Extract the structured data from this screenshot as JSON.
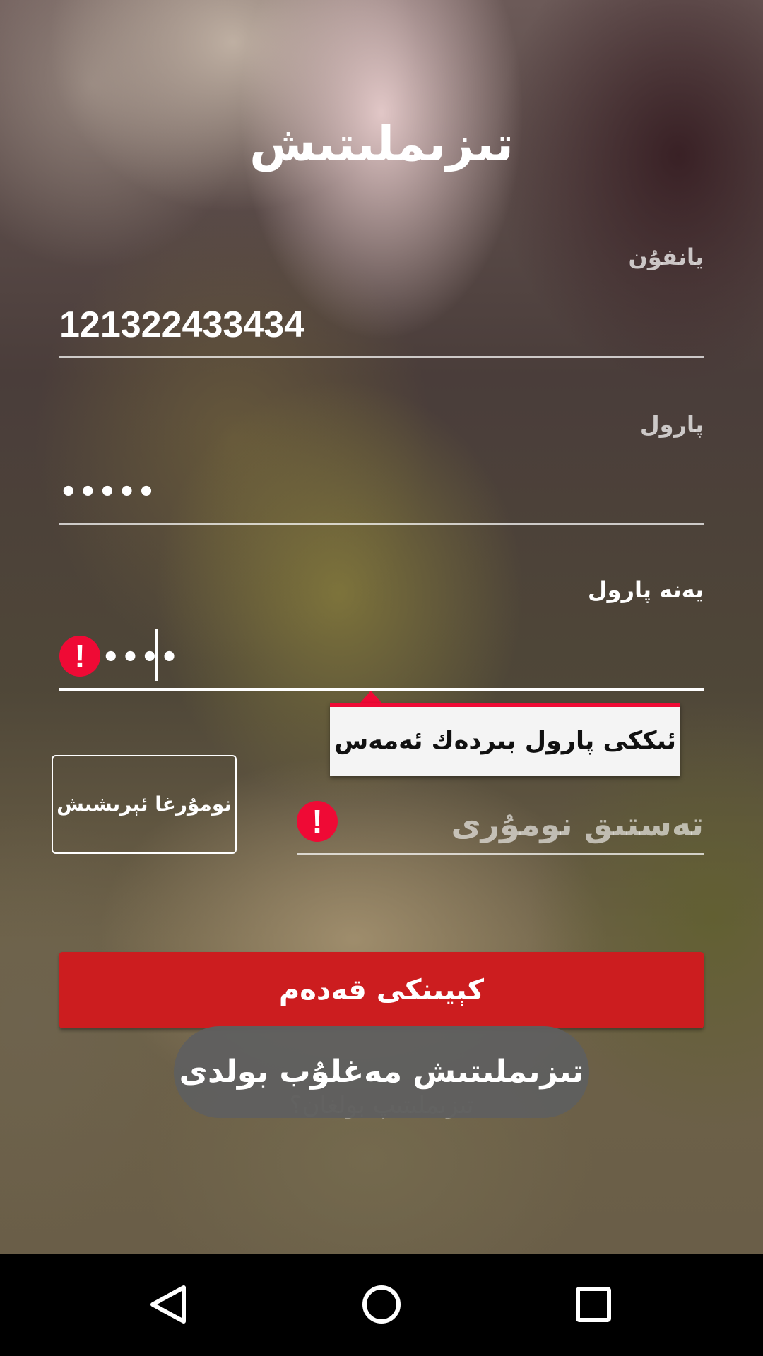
{
  "screen": {
    "title": "تىزىملىتىش"
  },
  "form": {
    "phone": {
      "label": "يانفۇن",
      "value": "121322433434"
    },
    "password": {
      "label": "پارول",
      "value": "•••••"
    },
    "confirm_password": {
      "label": "يەنە پارول",
      "value": "••••",
      "error_message": "ئىككى پارول بىردەك ئەمەس"
    },
    "send_code_button": "نومۇرغا ئېرىشىش",
    "verify_code": {
      "placeholder": "تەستىق نومۇرى"
    },
    "primary_button": "كېيىنكى قەدەم",
    "secondary_link": "تىزىملىتىپ بولغان؟"
  },
  "toast": {
    "message": "تىزىملىتىش مەغلۇب بولدى"
  },
  "nav": {
    "back": "back-icon",
    "home": "home-icon",
    "recents": "recents-icon"
  },
  "colors": {
    "error": "#ef0a35",
    "primary_button": "#cc1d1f",
    "toast_bg": "#5f5f5f"
  }
}
